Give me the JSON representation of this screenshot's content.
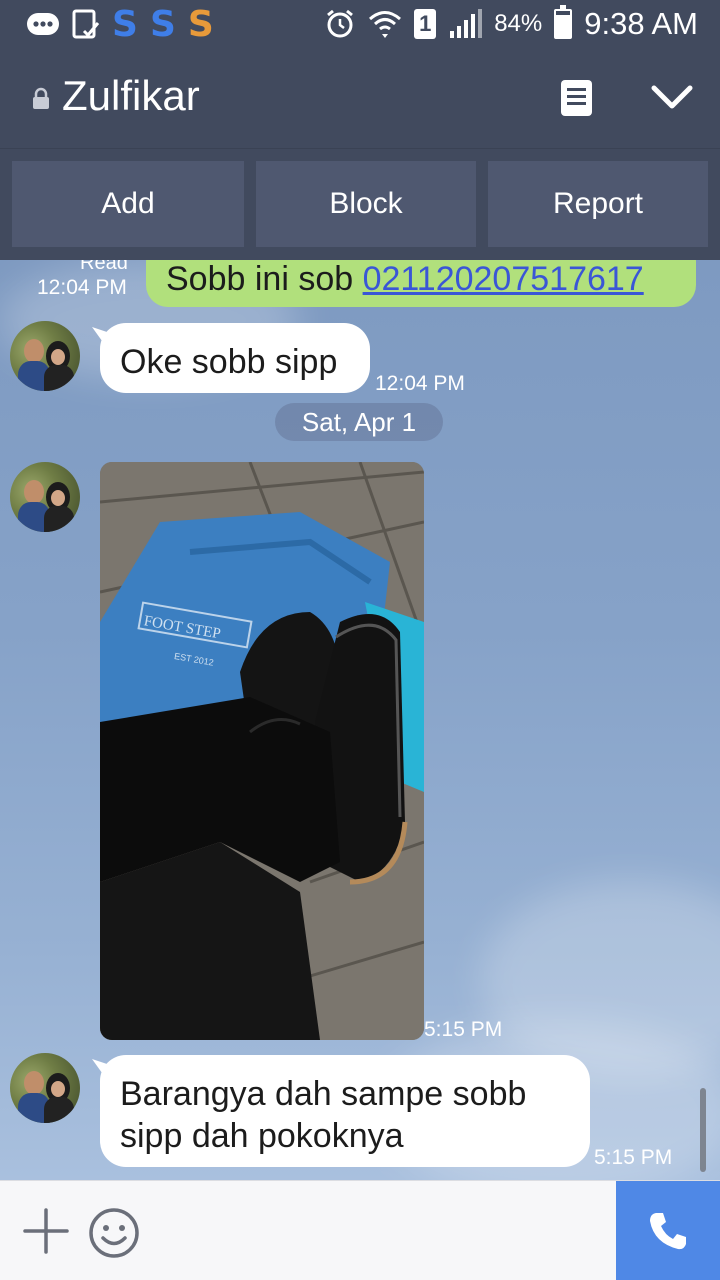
{
  "status_bar": {
    "icons": [
      "message-icon",
      "clipboard-icon",
      "s-app-icon-blue",
      "s-app-icon-blue",
      "s-app-icon-orange",
      "alarm-icon",
      "wifi-icon",
      "sim-icon",
      "signal-icon",
      "battery-icon"
    ],
    "app_glyph": "S",
    "sim_label": "1",
    "battery_percent": "84%",
    "battery_level": 0.84,
    "time": "9:38 AM",
    "colors": {
      "background": "#414a5e",
      "s_blue": "#3f7ee8",
      "s_orange": "#e89a3a"
    }
  },
  "header": {
    "contact_name": "Zulfikar",
    "icons": [
      "lock-icon",
      "note-icon",
      "chevron-down-icon"
    ]
  },
  "actions": {
    "add_label": "Add",
    "block_label": "Block",
    "report_label": "Report"
  },
  "messages": [
    {
      "direction": "sent",
      "read_label": "Read",
      "time": "12:04 PM",
      "text": "Sobb ini sob ",
      "link": "021120207517617"
    },
    {
      "direction": "received",
      "time": "12:04 PM",
      "text": "Oke sobb sipp"
    },
    {
      "type": "date_divider",
      "text": "Sat, Apr 1"
    },
    {
      "direction": "received",
      "type": "image",
      "time": "5:15 PM",
      "image_label": "FOOT STEP",
      "image_sublabel": "EST 2012"
    },
    {
      "direction": "received",
      "time": "5:15 PM",
      "text": "Barangya dah sampe sobb sipp dah pokoknya"
    }
  ],
  "input_bar": {
    "icons": [
      "plus-icon",
      "emoji-icon",
      "phone-icon"
    ]
  },
  "colors": {
    "header_bg": "#414a5e",
    "button_bg": "#4f5870",
    "sent_bubble": "#b1e07c",
    "received_bubble": "#ffffff",
    "link": "#3a56d6",
    "call_button": "#4f88e6"
  }
}
